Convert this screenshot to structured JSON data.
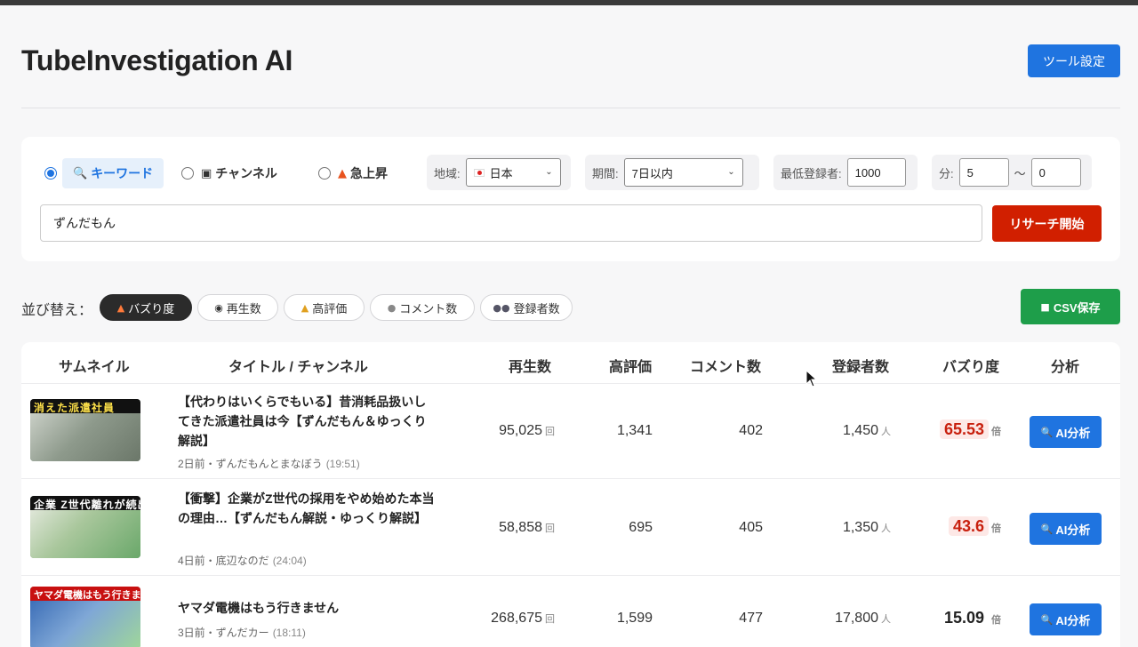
{
  "app": {
    "title": "TubeInvestigation AI",
    "settings_label": "ツール設定"
  },
  "search": {
    "modes": [
      {
        "label": "キーワード",
        "icon": "magnifier-icon",
        "selected": true
      },
      {
        "label": "チャンネル",
        "icon": "monitor-icon",
        "selected": false
      },
      {
        "label": "急上昇",
        "icon": "fire-icon",
        "selected": false
      }
    ],
    "region": {
      "label": "地域:",
      "value": "日本",
      "flag": "japan-flag-icon"
    },
    "period": {
      "label": "期間:",
      "value": "7日以内"
    },
    "min_subscribers": {
      "label": "最低登録者:",
      "value": "1000"
    },
    "minutes": {
      "label": "分:",
      "from": "5",
      "separator": "〜",
      "to": "0"
    },
    "keyword": "ずんだもん",
    "submit_label": "リサーチ開始"
  },
  "sort": {
    "label": "並び替え：",
    "options": [
      {
        "label": "バズり度",
        "icon": "fire-icon",
        "active": true
      },
      {
        "label": "再生数",
        "icon": "eye-icon",
        "active": false
      },
      {
        "label": "高評価",
        "icon": "thumbs-up-icon",
        "active": false
      },
      {
        "label": "コメント数",
        "icon": "speech-bubble-icon",
        "active": false
      },
      {
        "label": "登録者数",
        "icon": "people-icon",
        "active": false
      }
    ],
    "csv_label": "CSV保存"
  },
  "table": {
    "headers": {
      "thumbnail": "サムネイル",
      "title_channel": "タイトル / チャンネル",
      "views": "再生数",
      "likes": "高評価",
      "comments": "コメント数",
      "subscribers": "登録者数",
      "buzz": "バズり度",
      "analysis": "分析"
    },
    "units": {
      "views": "回",
      "subscribers": "人",
      "buzz": "倍"
    },
    "analyze_label": "AI分析",
    "rows": [
      {
        "thumb_text": "消えた派遣社員",
        "title": "【代わりはいくらでもいる】昔消耗品扱いしてきた派遣社員は今【ずんだもん＆ゆっくり解説】",
        "meta": "2日前・ずんだもんとまなぼう",
        "duration": "(19:51)",
        "views": "95,025",
        "likes": "1,341",
        "comments": "402",
        "subscribers": "1,450",
        "buzz": "65.53",
        "hot": true
      },
      {
        "thumb_text": "企業 Z世代離れが続出",
        "title": "【衝撃】企業がZ世代の採用をやめ始めた本当の理由…【ずんだもん解説・ゆっくり解説】",
        "meta": "4日前・底辺なのだ",
        "duration": "(24:04)",
        "views": "58,858",
        "likes": "695",
        "comments": "405",
        "subscribers": "1,350",
        "buzz": "43.6",
        "hot": true
      },
      {
        "thumb_text": "ヤマダ電機はもう行きません",
        "title": "ヤマダ電機はもう行きません",
        "meta": "3日前・ずんだカー",
        "duration": "(18:11)",
        "views": "268,675",
        "likes": "1,599",
        "comments": "477",
        "subscribers": "17,800",
        "buzz": "15.09",
        "hot": false
      }
    ]
  },
  "colors": {
    "primary": "#1f74e0",
    "danger": "#d11f00",
    "success": "#1e9e4a",
    "hot_text": "#c8200e"
  }
}
